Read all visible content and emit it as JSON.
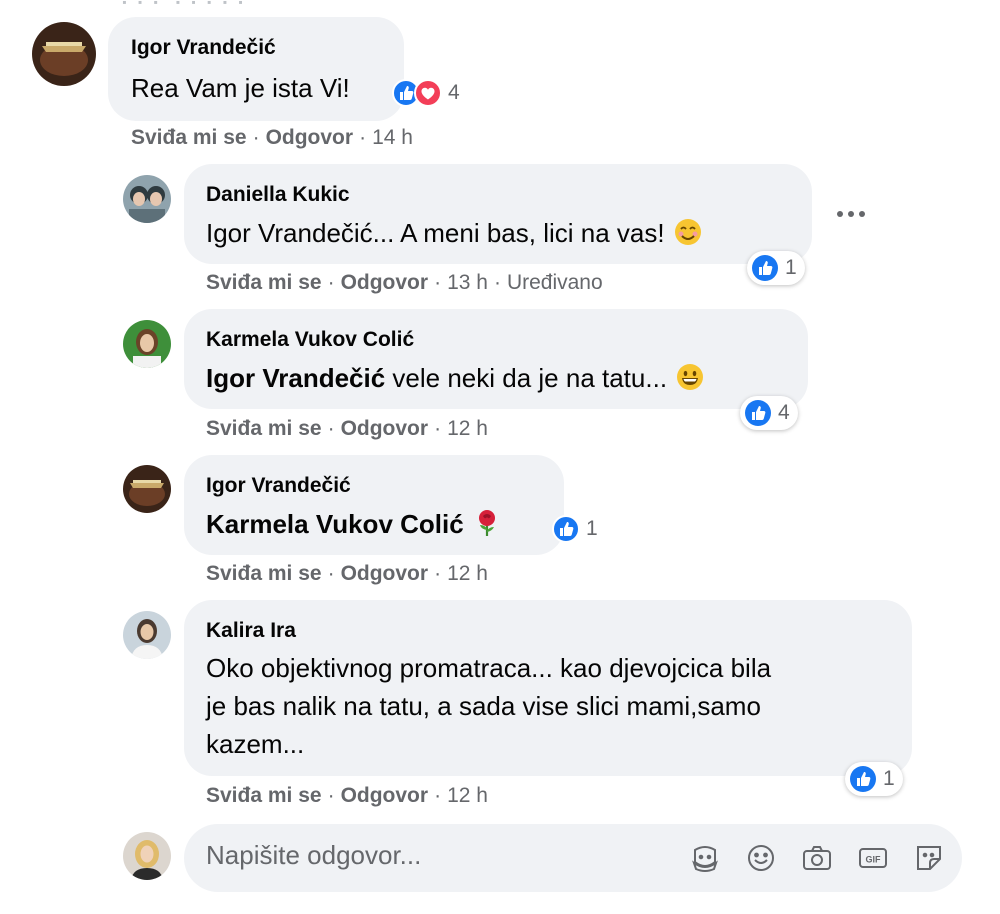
{
  "comment_main": {
    "author": "Igor Vrandečić",
    "text": "Rea Vam je ista Vi!",
    "reaction_count": "4",
    "like": "Sviđa mi se",
    "reply": "Odgovor",
    "time": "14 h"
  },
  "replies": [
    {
      "author": "Daniella Kukic",
      "text": "Igor Vrandečić... A meni bas, lici na vas!",
      "reaction_count": "1",
      "like": "Sviđa mi se",
      "reply": "Odgovor",
      "time": "13 h",
      "edited": "Uređivano",
      "emoji": "smiling-face-icon"
    },
    {
      "author": "Karmela Vukov Colić",
      "mention": "Igor Vrandečić",
      "text": " vele neki da je na tatu...",
      "reaction_count": "4",
      "like": "Sviđa mi se",
      "reply": "Odgovor",
      "time": "12 h",
      "emoji": "grinning-face-icon"
    },
    {
      "author": "Igor Vrandečić",
      "mention": "Karmela Vukov Colić",
      "reaction_count": "1",
      "like": "Sviđa mi se",
      "reply": "Odgovor",
      "time": "12 h",
      "emoji": "rose-icon"
    },
    {
      "author": "Kalira Ira",
      "text_lines": [
        "Oko objektivnog promatraca... kao djevojcica bila",
        "je bas nalik na tatu, a sada vise slici mami,samo",
        "kazem..."
      ],
      "reaction_count": "1",
      "like": "Sviđa mi se",
      "reply": "Odgovor",
      "time": "12 h"
    }
  ],
  "reply_box": {
    "placeholder": "Napišite odgovor...",
    "tools": [
      "sticker-face-icon",
      "emoji-icon",
      "camera-icon",
      "gif-icon",
      "sticker-icon"
    ]
  },
  "colors": {
    "bubble": "#f0f2f5",
    "meta": "#65676b",
    "like_blue": "#1877f2",
    "love_red": "#f33e58"
  }
}
